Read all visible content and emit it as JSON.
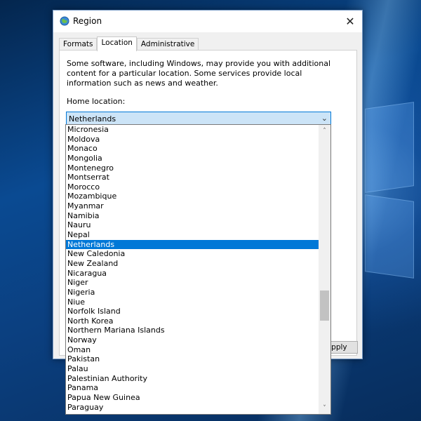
{
  "window": {
    "title": "Region",
    "close_glyph": "✕"
  },
  "tabs": [
    {
      "label": "Formats"
    },
    {
      "label": "Location"
    },
    {
      "label": "Administrative"
    }
  ],
  "location": {
    "description": "Some software, including Windows, may provide you with additional content for a particular location. Some services provide local information such as news and weather.",
    "home_label": "Home location:",
    "selected_value": "Netherlands",
    "arrow_glyph": "⌄"
  },
  "buttons": {
    "apply_label": "Apply"
  },
  "dropdown": {
    "items": [
      "Micronesia",
      "Moldova",
      "Monaco",
      "Mongolia",
      "Montenegro",
      "Montserrat",
      "Morocco",
      "Mozambique",
      "Myanmar",
      "Namibia",
      "Nauru",
      "Nepal",
      "Netherlands",
      "New Caledonia",
      "New Zealand",
      "Nicaragua",
      "Niger",
      "Nigeria",
      "Niue",
      "Norfolk Island",
      "North Korea",
      "Northern Mariana Islands",
      "Norway",
      "Oman",
      "Pakistan",
      "Palau",
      "Palestinian Authority",
      "Panama",
      "Papua New Guinea",
      "Paraguay"
    ],
    "selected_index": 12,
    "scroll_up_glyph": "˄",
    "scroll_down_glyph": "˅",
    "scroll_fraction": 0.62
  },
  "colors": {
    "selection": "#0078d7",
    "combo_bg": "#cce4f7"
  },
  "icons": {
    "title": "globe-region-icon",
    "close": "close-icon",
    "dropdown": "chevron-down-icon"
  }
}
